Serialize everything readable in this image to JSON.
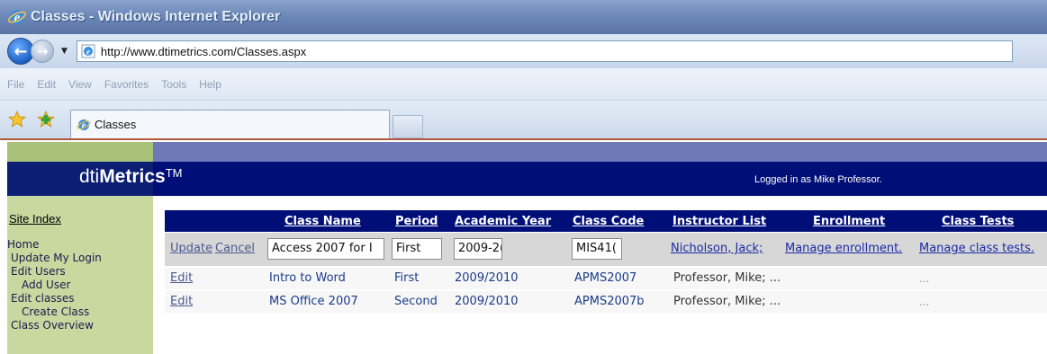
{
  "window": {
    "title": "Classes - Windows Internet Explorer"
  },
  "address_bar": {
    "url": "http://www.dtimetrics.com/Classes.aspx"
  },
  "menu": [
    "File",
    "Edit",
    "View",
    "Favorites",
    "Tools",
    "Help"
  ],
  "tab": {
    "label": "Classes"
  },
  "site": {
    "logo_prefix": "dti",
    "logo_bold": "Metrics",
    "logo_tm": "TM",
    "logged_in_text": "Logged in as Mike Professor."
  },
  "sidebar": {
    "site_index": "Site Index",
    "items": [
      {
        "label": "Home",
        "level": 0
      },
      {
        "label": "Update My Login",
        "level": 1
      },
      {
        "label": "Edit Users",
        "level": 1
      },
      {
        "label": "Add User",
        "level": 2
      },
      {
        "label": "Edit classes",
        "level": 1
      },
      {
        "label": "Create Class",
        "level": 2
      },
      {
        "label": "Class Overview",
        "level": 1
      }
    ]
  },
  "grid": {
    "headers": {
      "class_name": "Class Name",
      "period": "Period",
      "academic_year": "Academic Year",
      "class_code": "Class Code",
      "instructor_list": "Instructor List",
      "enrollment": "Enrollment",
      "class_tests": "Class Tests"
    },
    "edit_row": {
      "update": "Update",
      "cancel": "Cancel",
      "class_name_value": "Access 2007 for I",
      "period_value": "First",
      "academic_year_value": "2009-2(",
      "class_code_value": "MIS41(",
      "instructor_link": "Nicholson, Jack;",
      "enrollment_link": "Manage enrollment.",
      "class_tests_link": "Manage class tests."
    },
    "rows": [
      {
        "edit": "Edit",
        "class_name": "Intro to Word",
        "period": "First",
        "academic_year": "2009/2010",
        "class_code": "APMS2007",
        "instructor": "Professor, Mike; ...",
        "class_tests": "..."
      },
      {
        "edit": "Edit",
        "class_name": "MS Office 2007",
        "period": "Second",
        "academic_year": "2009/2010",
        "class_code": "APMS2007b",
        "instructor": "Professor, Mike; ...",
        "class_tests": "..."
      }
    ]
  },
  "colors": {
    "banner": "#000e78",
    "sidebar": "#c8d9a0",
    "link": "#1a2aa5"
  }
}
